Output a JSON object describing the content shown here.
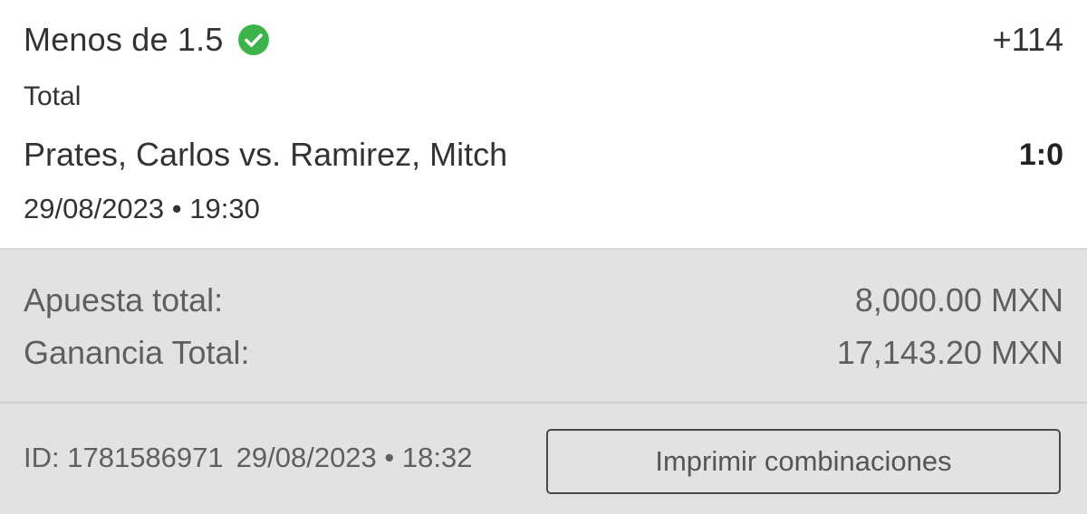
{
  "bet": {
    "selection": "Menos de 1.5",
    "status_icon": "check-circle-icon",
    "status_color": "#3cb44b",
    "odds": "+114",
    "market": "Total",
    "event": "Prates, Carlos vs. Ramirez, Mitch",
    "score": "1:0",
    "datetime": "29/08/2023 • 19:30"
  },
  "summary": {
    "stake_label": "Apuesta total:",
    "stake_value": "8,000.00 MXN",
    "payout_label": "Ganancia Total:",
    "payout_value": "17,143.20 MXN"
  },
  "footer": {
    "id_text": "ID: 1781586971",
    "placed_datetime": "29/08/2023 • 18:32",
    "print_button_label": "Imprimir combinaciones"
  }
}
